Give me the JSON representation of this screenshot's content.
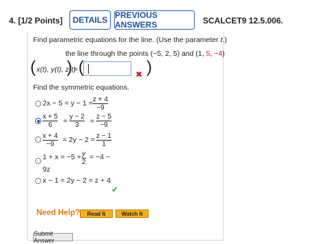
{
  "header": {
    "question_number": "4.",
    "points": "[1/2 Points]",
    "details_label": "DETAILS",
    "previous_answers_label": "PREVIOUS ANSWERS",
    "problem_code": "SCALCET9 12.5.006."
  },
  "prompt": {
    "instruction": "Find parametric equations for the line. (Use the parameter ",
    "param": "t",
    "instruction_end": ".)",
    "points_text_prefix": "the line through the points (−5, 2, 5) and (1, ",
    "points_red_5": "5",
    "points_text_mid": ", ",
    "points_red_neg4": "−4",
    "points_text_end": ")",
    "lhs": "x(t), y(t), z(t)",
    "equals": "=",
    "answer_value": ""
  },
  "symmetric": {
    "heading": "Find the symmetric equations.",
    "options": [
      {
        "id": "a",
        "selected": false
      },
      {
        "id": "b",
        "selected": true
      },
      {
        "id": "c",
        "selected": false
      },
      {
        "id": "d",
        "selected": false
      },
      {
        "id": "e",
        "selected": false
      }
    ],
    "opt_a_prefix": "2x − 5 = y − 1 =",
    "opt_a_num": "z + 4",
    "opt_a_den": "−9",
    "opt_b_f1_num": "x + 5",
    "opt_b_f1_den": "6",
    "opt_b_f2_num": "y − 2",
    "opt_b_f2_den": "3",
    "opt_b_f3_num": "z − 5",
    "opt_b_f3_den": "−9",
    "opt_c_f1_num": "x + 4",
    "opt_c_f1_den": "−9",
    "opt_c_mid": "= 2y − 2 =",
    "opt_c_f2_num": "z − 1",
    "opt_c_f2_den": "1",
    "opt_d_prefix": "1 + x = −5 +",
    "opt_d_num": "y",
    "opt_d_den": "2",
    "opt_d_suffix": "= −4 −",
    "opt_d_line2": "9z",
    "opt_e": "x − 1 = 2y − 2 = z + 4",
    "eq": "="
  },
  "help": {
    "need_help": "Need Help?",
    "read_it": "Read It",
    "watch_it": "Watch It"
  },
  "footer": {
    "submit_label": "Submit Answer"
  },
  "colors": {
    "accent_blue": "#1f4f9c",
    "error_red": "#cc1f1f",
    "correct_green": "#3aa84a",
    "help_orange": "#e87a10",
    "help_button": "#f4b024"
  }
}
